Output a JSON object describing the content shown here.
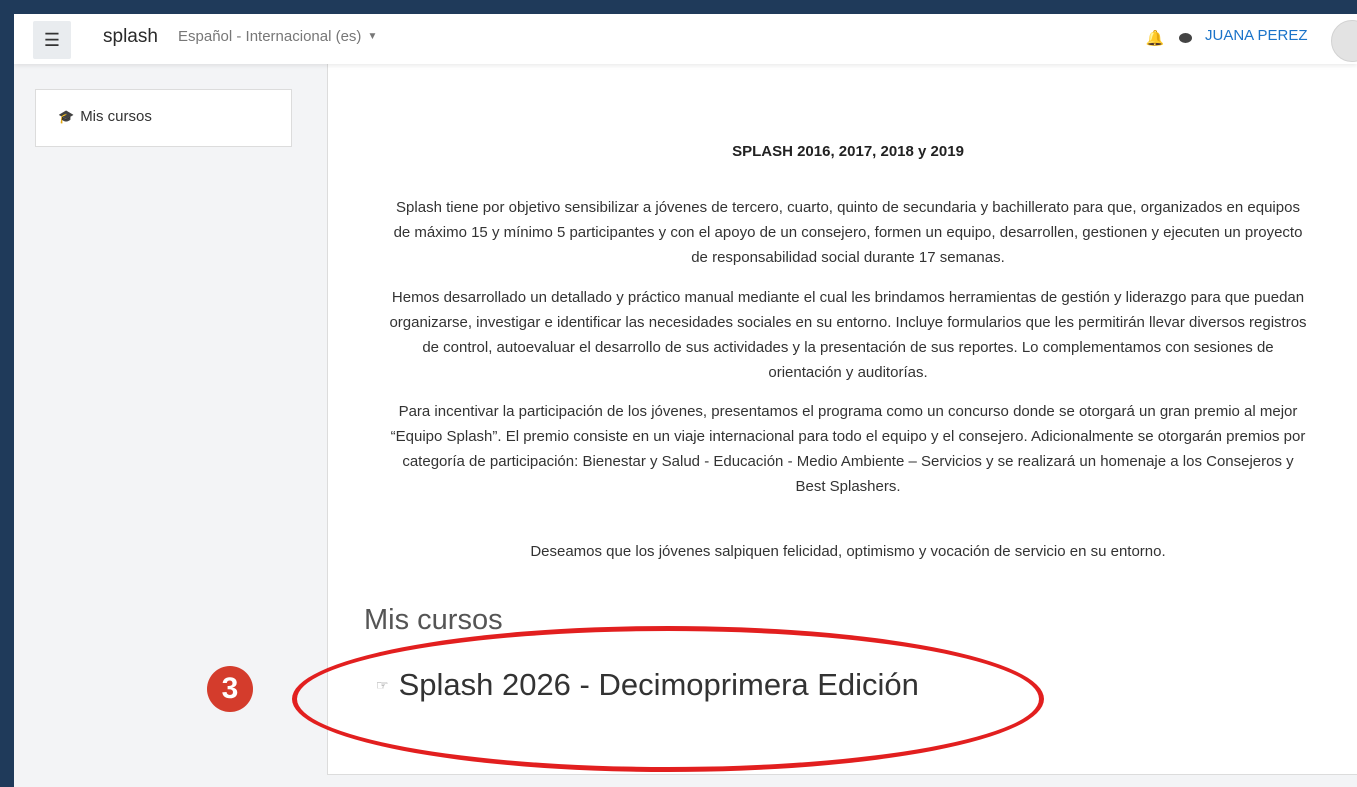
{
  "navbar": {
    "brand": "splash",
    "language": "Español - Internacional (es)",
    "user_name": "JUANA PEREZ"
  },
  "sidebar": {
    "items": [
      {
        "label": "Mis cursos",
        "icon": "graduation-cap-icon"
      }
    ]
  },
  "main": {
    "heading": "SPLASH 2016, 2017, 2018 y 2019",
    "paragraphs": [
      "Splash tiene por objetivo sensibilizar a jóvenes de tercero, cuarto, quinto de secundaria y bachillerato para que, organizados en equipos de máximo 15 y mínimo 5 participantes y con el apoyo de un consejero, formen un equipo, desarrollen, gestionen y ejecuten un proyecto de responsabilidad social durante 17 semanas.",
      "Hemos desarrollado un detallado y práctico manual mediante el cual les brindamos herramientas de gestión y liderazgo para que puedan organizarse, investigar e identificar las necesidades sociales en su entorno. Incluye formularios que les permitirán llevar diversos registros de control, autoevaluar el desarrollo de sus actividades y la presentación de sus reportes. Lo complementamos con sesiones de orientación y auditorías.",
      "Para incentivar la participación de los jóvenes, presentamos el programa como un concurso donde se otorgará un gran premio al mejor “Equipo Splash”. El premio consiste en un viaje internacional para todo el equipo y el consejero.  Adicionalmente se otorgarán premios por categoría de participación: Bienestar y Salud - Educación - Medio Ambiente – Servicios y se realizará un homenaje a los Consejeros y Best Splashers.",
      "Deseamos que los jóvenes salpiquen felicidad, optimismo y vocación de servicio en su entorno."
    ],
    "courses_title": "Mis cursos",
    "courses": [
      {
        "label": "Splash 2026 - Decimoprimera Edición"
      }
    ]
  },
  "annotation": {
    "step_number": "3",
    "color": "#e21f1f"
  }
}
